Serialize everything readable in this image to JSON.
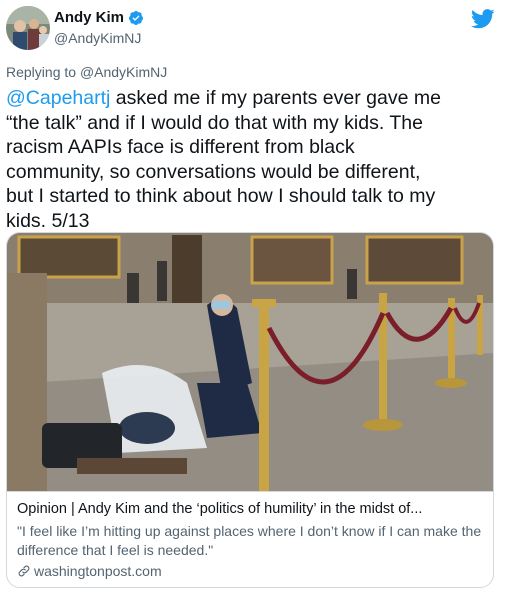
{
  "author": {
    "display_name": "Andy Kim",
    "handle": "@AndyKimNJ",
    "verified": true
  },
  "reply": {
    "prefix": "Replying to ",
    "mention": "@AndyKimNJ"
  },
  "tweet": {
    "mention": "@Capehartj",
    "text": " asked me if my parents ever gave me\n“the talk” and if I would do that with my kids. The\nracism AAPIs face is different from black\ncommunity, so conversations would be different,\nbut I started to think about how I should talk to my\nkids. 5/13"
  },
  "card": {
    "title": "Opinion | Andy Kim and the ‘politics of humility’ in the midst of...",
    "description": "\"I feel like I’m hitting up against places where I don’t know if I can make the difference that I feel is needed.\"",
    "domain": "washingtonpost.com"
  },
  "icons": {
    "verified": "verified-badge-icon",
    "bird": "twitter-bird-icon",
    "link": "link-icon"
  },
  "colors": {
    "accent": "#1d9bf0",
    "secondary_text": "#536471",
    "border": "#cfd9de"
  }
}
